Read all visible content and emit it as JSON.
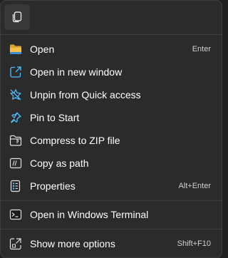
{
  "menu": {
    "top_actions": [
      {
        "icon": "copy-icon"
      }
    ],
    "items": [
      {
        "label": "Open",
        "shortcut": "Enter",
        "icon": "folder-icon"
      },
      {
        "label": "Open in new window",
        "shortcut": "",
        "icon": "open-new-window-icon"
      },
      {
        "label": "Unpin from Quick access",
        "shortcut": "",
        "icon": "unpin-star-icon"
      },
      {
        "label": "Pin to Start",
        "shortcut": "",
        "icon": "pin-icon"
      },
      {
        "label": "Compress to ZIP file",
        "shortcut": "",
        "icon": "zip-folder-icon"
      },
      {
        "label": "Copy as path",
        "shortcut": "",
        "icon": "copy-path-icon"
      },
      {
        "label": "Properties",
        "shortcut": "Alt+Enter",
        "icon": "properties-icon"
      },
      {
        "label": "Open in Windows Terminal",
        "shortcut": "",
        "icon": "terminal-icon"
      },
      {
        "label": "Show more options",
        "shortcut": "Shift+F10",
        "icon": "more-options-icon"
      }
    ]
  },
  "colors": {
    "background": "#2b2b2b",
    "text": "#ffffff",
    "accent": "#4cc2ff",
    "folder": "#f5c04a"
  }
}
